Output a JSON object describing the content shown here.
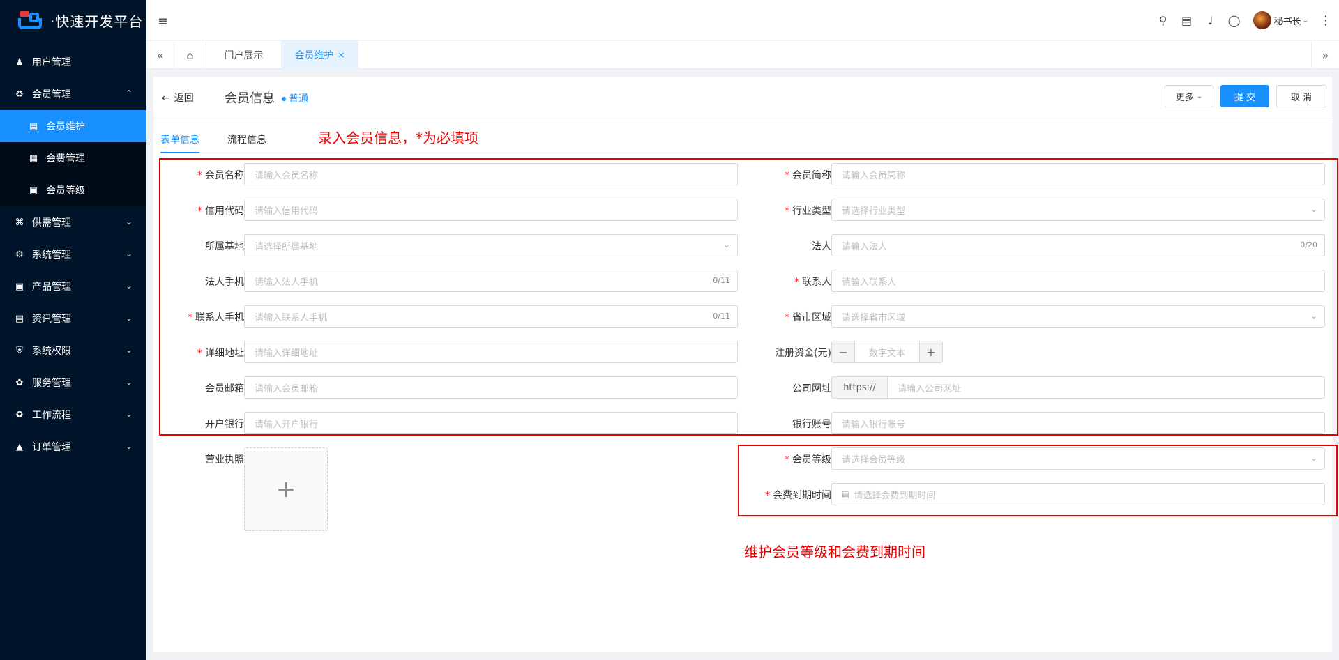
{
  "app": {
    "logo_text": "·快速开发平台"
  },
  "sidebar": {
    "items": [
      {
        "label": "用户管理"
      },
      {
        "label": "会员管理"
      },
      {
        "label": "会员维护"
      },
      {
        "label": "会费管理"
      },
      {
        "label": "会员等级"
      },
      {
        "label": "供需管理"
      },
      {
        "label": "系统管理"
      },
      {
        "label": "产品管理"
      },
      {
        "label": "资讯管理"
      },
      {
        "label": "系统权限"
      },
      {
        "label": "服务管理"
      },
      {
        "label": "工作流程"
      },
      {
        "label": "订单管理"
      }
    ]
  },
  "header": {
    "user_name": "秘书长"
  },
  "tabs": {
    "items": [
      {
        "label": "门户展示"
      },
      {
        "label": "会员维护"
      }
    ]
  },
  "page": {
    "back_label": "返回",
    "title": "会员信息",
    "badge": "普通",
    "more_label": "更多",
    "submit_label": "提 交",
    "cancel_label": "取 消",
    "form_tabs": [
      {
        "label": "表单信息"
      },
      {
        "label": "流程信息"
      }
    ]
  },
  "form": {
    "member_name": {
      "label": "会员名称",
      "placeholder": "请输入会员名称"
    },
    "member_short": {
      "label": "会员简称",
      "placeholder": "请输入会员简称"
    },
    "credit_code": {
      "label": "信用代码",
      "placeholder": "请输入信用代码"
    },
    "industry": {
      "label": "行业类型",
      "placeholder": "请选择行业类型"
    },
    "base": {
      "label": "所属基地",
      "placeholder": "请选择所属基地"
    },
    "legal": {
      "label": "法人",
      "placeholder": "请输入法人",
      "counter": "0/20"
    },
    "legal_phone": {
      "label": "法人手机",
      "placeholder": "请输入法人手机",
      "counter": "0/11"
    },
    "contact": {
      "label": "联系人",
      "placeholder": "请输入联系人"
    },
    "contact_phone": {
      "label": "联系人手机",
      "placeholder": "请输入联系人手机",
      "counter": "0/11"
    },
    "region": {
      "label": "省市区域",
      "placeholder": "请选择省市区域"
    },
    "address": {
      "label": "详细地址",
      "placeholder": "请输入详细地址"
    },
    "capital": {
      "label": "注册资金(元)",
      "placeholder": "数字文本"
    },
    "email": {
      "label": "会员邮箱",
      "placeholder": "请输入会员邮箱"
    },
    "website": {
      "label": "公司网址",
      "prefix": "https://",
      "placeholder": "请输入公司网址"
    },
    "bank": {
      "label": "开户银行",
      "placeholder": "请输入开户银行"
    },
    "account": {
      "label": "银行账号",
      "placeholder": "请输入银行账号"
    },
    "license": {
      "label": "营业执照"
    },
    "level": {
      "label": "会员等级",
      "placeholder": "请选择会员等级"
    },
    "expiry": {
      "label": "会费到期时间",
      "placeholder": "请选择会费到期时间"
    }
  },
  "annotations": {
    "top": "录入会员信息，*为必填项",
    "bottom": "维护会员等级和会费到期时间",
    "color": "#e60000"
  },
  "colors": {
    "accent": "#1890ff",
    "sidebar_bg": "#001529"
  }
}
